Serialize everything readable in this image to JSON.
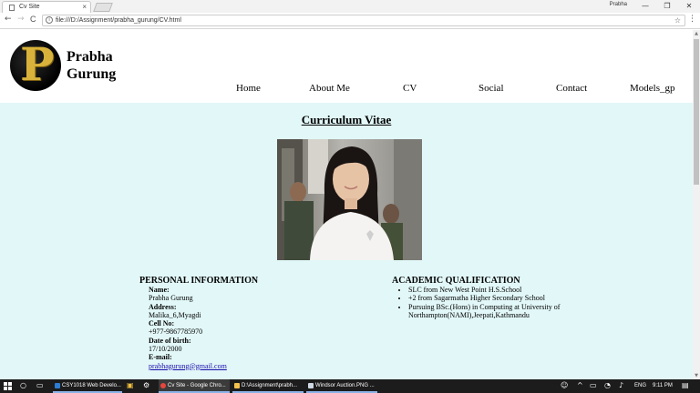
{
  "browser": {
    "tab_title": "Cv Site",
    "tab_close": "×",
    "profile_name": "Prabha",
    "win_min": "—",
    "win_max": "❐",
    "win_close": "✕",
    "back": "←",
    "forward": "→",
    "reload": "C",
    "url": "file:///D:/Assignment/prabha_gurung/CV.html",
    "info": "i",
    "star": "☆",
    "menu": "⋮"
  },
  "site": {
    "logo_letter": "P",
    "name_line1": "Prabha",
    "name_line2": "Gurung",
    "nav": [
      {
        "label": "Home"
      },
      {
        "label": "About Me"
      },
      {
        "label": "CV"
      },
      {
        "label": "Social"
      },
      {
        "label": "Contact"
      },
      {
        "label": "Models_gp"
      }
    ]
  },
  "cv": {
    "title": "Curriculum Vitae",
    "personal": {
      "heading": "PERSONAL INFORMATION",
      "name_label": "Name:",
      "name": "Prabha Gurung",
      "address_label": "Address:",
      "address": "Malika_6,Myagdi",
      "cell_label": "Cell No:",
      "cell": "+977-9867785970",
      "dob_label": "Date of birth:",
      "dob": "17/10/2000",
      "email_label": "E-mail:",
      "email": "prabhagurung@gmail.com"
    },
    "academic": {
      "heading": "ACADEMIC QUALIFICATION",
      "items": [
        "SLC from New West Point H.S.School",
        "+2 from Sagarmatha Higher Secondary School",
        "Pursuing BSc.(Hons) in Computing at University of Northampton(NAMI),Jeepati,Kathmandu"
      ]
    }
  },
  "taskbar": {
    "apps": [
      {
        "label": "CSY1018 Web Develo..."
      },
      {
        "label": "Cv Site - Google Chro..."
      },
      {
        "label": "D:\\Assignment\\prabh..."
      },
      {
        "label": "Windsor Auction.PNG ..."
      }
    ],
    "language": "ENG",
    "time": "9:11 PM"
  },
  "colors": {
    "content_bg": "#e2f7f8",
    "link": "#1a0dab",
    "logo_gold": "#d8b23a",
    "taskbar_bg": "#1c1c1c"
  }
}
